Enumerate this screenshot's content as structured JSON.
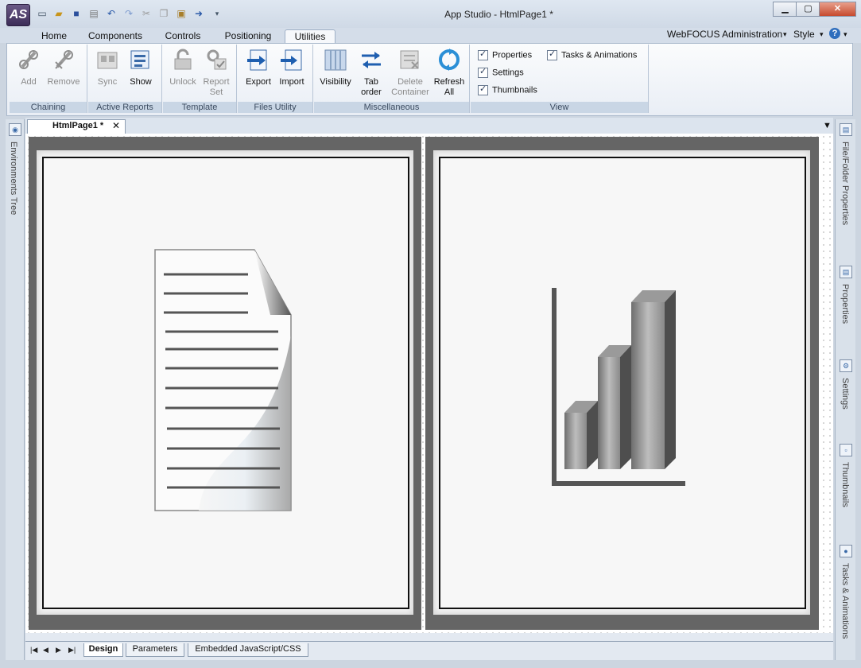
{
  "window": {
    "title": "App Studio - HtmlPage1 *",
    "logo": "AS"
  },
  "quick_access": [
    "new-icon",
    "open-icon",
    "save-icon",
    "print-icon",
    "undo-icon",
    "redo-icon",
    "cut-icon",
    "copy-icon",
    "paste-icon",
    "run-icon",
    "customize-icon"
  ],
  "ribbon_tabs": [
    "Home",
    "Components",
    "Controls",
    "Positioning",
    "Utilities"
  ],
  "active_tab": "Utilities",
  "header_right": {
    "admin": "WebFOCUS Administration",
    "style": "Style"
  },
  "groups": {
    "chaining": {
      "label": "Chaining",
      "buttons": [
        "Add",
        "Remove"
      ]
    },
    "active_reports": {
      "label": "Active Reports",
      "buttons": [
        "Sync",
        "Show"
      ]
    },
    "template": {
      "label": "Template",
      "buttons": [
        "Unlock",
        "Report",
        "Set"
      ]
    },
    "files_utility": {
      "label": "Files Utility",
      "buttons": [
        "Export",
        "Import"
      ]
    },
    "misc": {
      "label": "Miscellaneous",
      "buttons": [
        "Visibility",
        "Tab",
        "order",
        "Delete",
        "Container",
        "Refresh",
        "All"
      ]
    },
    "view": {
      "label": "View",
      "checks": [
        "Properties",
        "Settings",
        "Thumbnails",
        "Tasks & Animations"
      ]
    }
  },
  "document_tab": "HtmlPage1 *",
  "left_panel": "Environments Tree",
  "right_panels": [
    "File/Folder Properties",
    "Properties",
    "Settings",
    "Thumbnails",
    "Tasks & Animations"
  ],
  "bottom_tabs": [
    "Design",
    "Parameters",
    "Embedded JavaScript/CSS"
  ],
  "active_bottom_tab": "Design",
  "colors": {
    "ribbon_bg": "#e9eef5",
    "canvas_frame": "#656565",
    "accent": "#3a6aa8"
  }
}
